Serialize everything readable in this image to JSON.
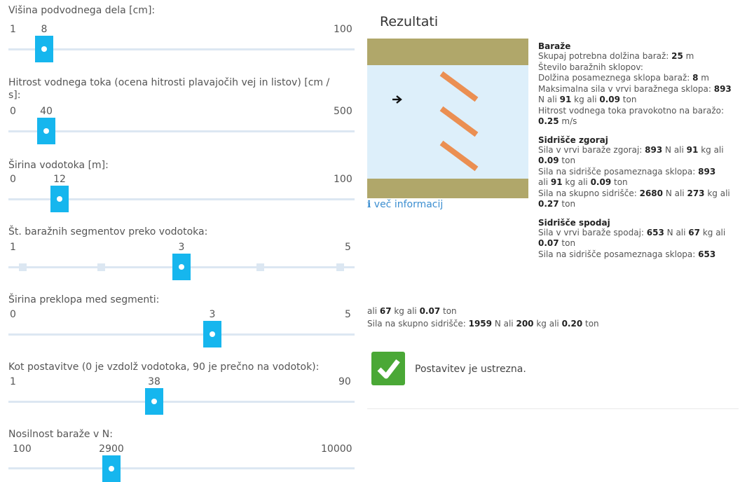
{
  "sliders": [
    {
      "label": "Višina podvodnega dela [cm]:",
      "min": "1",
      "max": "100",
      "value": "8"
    },
    {
      "label": "Hitrost vodnega toka (ocena hitrosti plavajočih vej in listov) [cm /",
      "label2": "s]:",
      "min": "0",
      "max": "500",
      "value": "40"
    },
    {
      "label": "Širina vodotoka [m]:",
      "min": "0",
      "max": "100",
      "value": "12"
    },
    {
      "label": "Št. baražnih segmentov preko vodotoka:",
      "min": "1",
      "max": "5",
      "value": "3"
    },
    {
      "label": "Širina preklopa med segmenti:",
      "min": "0",
      "max": "5",
      "value": "3"
    },
    {
      "label": "Kot postavitve (0 je vzdolž vodotoka, 90 je prečno na vodotok):",
      "min": "1",
      "max": "90",
      "value": "38"
    },
    {
      "label": "Nosilnost baraže v N:",
      "min": "100",
      "max": "10000",
      "value": "2900"
    }
  ],
  "results": {
    "title": "Rezultati",
    "more_info": "več informacij",
    "barriers": {
      "heading": "Baraže",
      "total_length_label": "Skupaj potrebna dolžina baraž: ",
      "total_length_value": "25",
      "total_length_unit": " m",
      "count_label": "Število baražnih sklopov:",
      "segment_length_label": "Dolžina posameznega sklopa baraž: ",
      "segment_length_value": "8",
      "segment_length_unit": " m",
      "max_force_label": "Maksimalna sila v vrvi baražnega sklopa: ",
      "max_force_n": "893",
      "max_force_kg": "91",
      "max_force_ton": "0.09",
      "velocity_label": "Hitrost vodnega toka pravokotno na baražo:",
      "velocity_value": "0.25",
      "velocity_unit": " m/s"
    },
    "upper": {
      "heading": "Sidrišče zgoraj",
      "rope_label": "Sila v vrvi baraže zgoraj: ",
      "rope_n": "893",
      "rope_kg": "91",
      "rope_ton": "0.09",
      "single_label": "Sila na sidrišče posameznaga sklopa: ",
      "single_n": "893",
      "single_kg": "91",
      "single_ton": "0.09",
      "total_label": "Sila na skupno sidrišče: ",
      "total_n": "2680",
      "total_kg": "273",
      "total_ton": "0.27"
    },
    "lower": {
      "heading": "Sidrišče spodaj",
      "rope_label": "Sila v vrvi baraže spodaj: ",
      "rope_n": "653",
      "rope_kg": "67",
      "rope_ton": "0.07",
      "single_label": "Sila na sidrišče posameznaga sklopa: ",
      "single_n": "653",
      "single_kg": "67",
      "single_ton": "0.07",
      "total_label": "Sila na skupno sidrišče: ",
      "total_n": "1959",
      "total_kg": "200",
      "total_ton": "0.20"
    },
    "words": {
      "n_ali": " N ali ",
      "kg_ali": " kg ali ",
      "ton": " ton",
      "ali": "ali "
    },
    "status": "Postavitev je ustrezna."
  },
  "colors": {
    "accent": "#16b6ee",
    "bank": "#b0a76a",
    "water": "#ddeffa",
    "boom": "#eb8f52",
    "ok": "#4aa836"
  }
}
